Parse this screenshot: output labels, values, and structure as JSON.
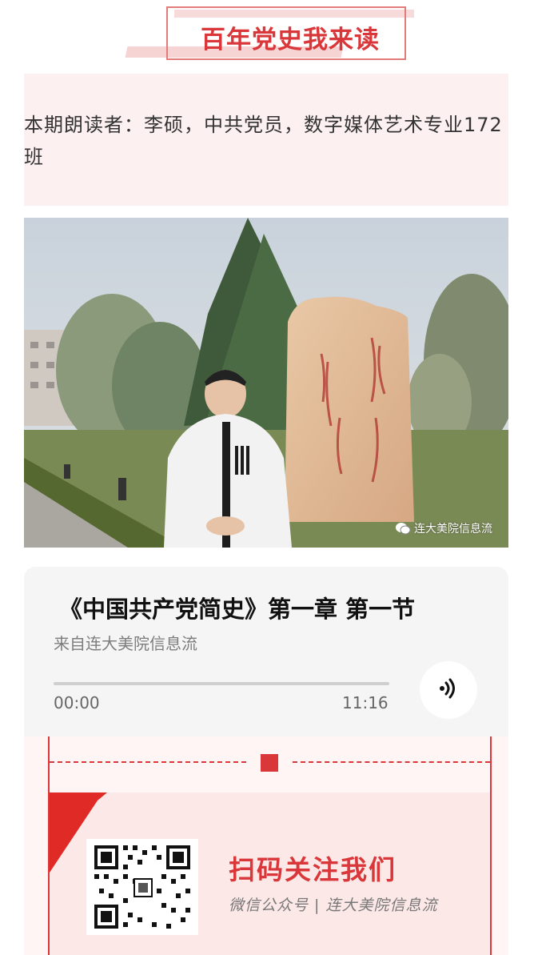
{
  "header": {
    "title": "百年党史我来读"
  },
  "reader": {
    "text": "本期朗读者：李硕，中共党员，数字媒体艺术专业172班"
  },
  "photo": {
    "watermark": "连大美院信息流"
  },
  "player": {
    "title": "《中国共产党简史》第一章 第一节",
    "source": "来自连大美院信息流",
    "current_time": "00:00",
    "total_time": "11:16",
    "progress": 0
  },
  "footer": {
    "heading": "扫码关注我们",
    "subtitle": "微信公众号 | 连大美院信息流"
  },
  "colors": {
    "accent": "#d9373a",
    "pink_bg": "#fdf0f0"
  }
}
